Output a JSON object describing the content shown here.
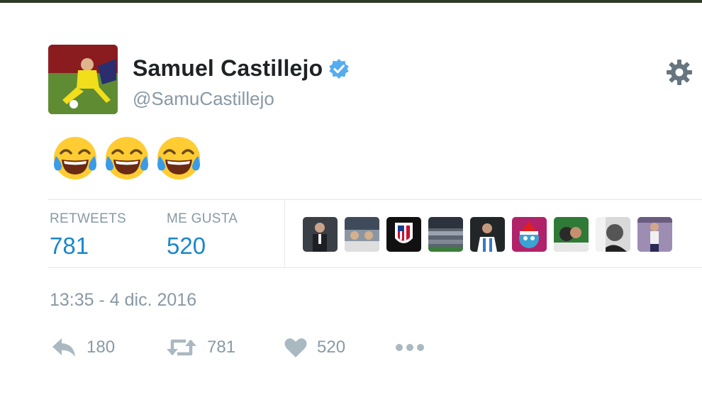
{
  "tweet": {
    "display_name": "Samuel Castillejo",
    "handle": "@SamuCastillejo",
    "verified": true,
    "body_emojis": [
      "face-with-tears-of-joy",
      "face-with-tears-of-joy",
      "face-with-tears-of-joy"
    ],
    "timestamp": "13:35 - 4 dic. 2016"
  },
  "stats": {
    "retweets_label": "RETWEETS",
    "retweets_value": "781",
    "likes_label": "ME GUSTA",
    "likes_value": "520"
  },
  "actions": {
    "reply_count": "180",
    "retweet_count": "781",
    "like_count": "520"
  },
  "colors": {
    "link_blue": "#1b87c9",
    "muted_gray": "#8899a6",
    "verified_blue": "#55acee",
    "divider": "#e1e8ed"
  },
  "icons": [
    "gear-icon",
    "verified-badge-icon",
    "reply-icon",
    "retweet-icon",
    "heart-icon",
    "more-icon"
  ]
}
